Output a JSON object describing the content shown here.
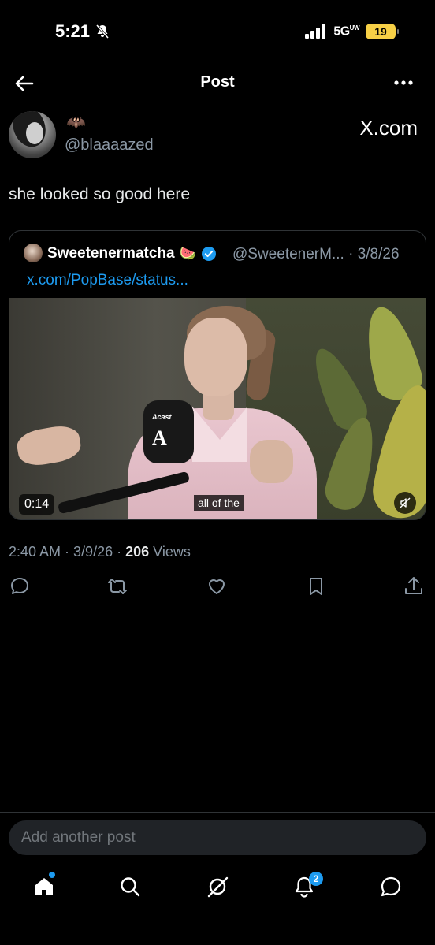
{
  "status_bar": {
    "time": "5:21",
    "network": "5G",
    "network_sup": "UW",
    "battery": "19"
  },
  "header": {
    "title": "Post"
  },
  "author": {
    "handle": "@blaaaazed",
    "name_emoji": "🦇"
  },
  "brand": {
    "text": "X.com"
  },
  "post": {
    "text": "she looked so good here",
    "time": "2:40 AM",
    "date": "3/9/26",
    "views_count": "206",
    "views_label": "Views"
  },
  "quote": {
    "name": "Sweetenermatcha",
    "name_emoji": "🍉",
    "handle": "@SweetenerM...",
    "date": "3/8/26",
    "link": "x.com/PopBase/status...",
    "video": {
      "duration": "0:14",
      "caption": "all of the",
      "mic_brand": "Acast",
      "mic_letter": "A"
    }
  },
  "reply": {
    "placeholder": "Add another post"
  },
  "tabs": {
    "notifications_badge": "2"
  },
  "colors": {
    "accent": "#1d9bf0",
    "background": "#000000",
    "muted": "#8b98a5"
  }
}
